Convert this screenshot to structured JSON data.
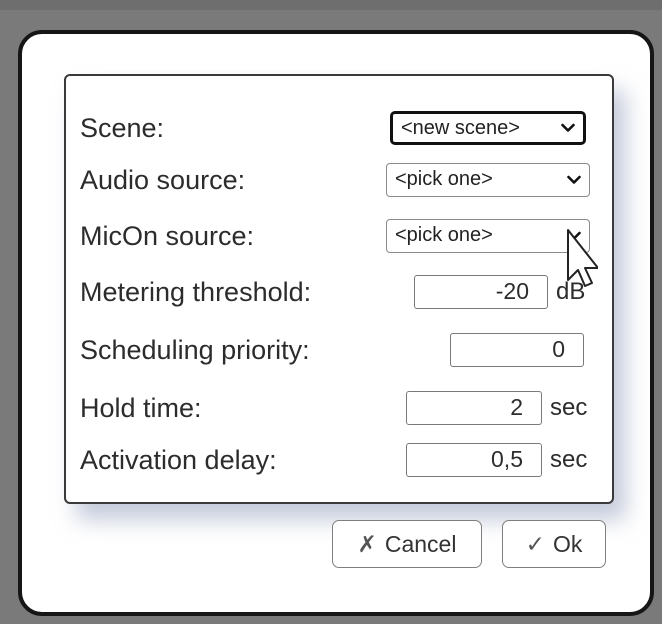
{
  "form": {
    "rows": [
      {
        "label": "Scene:",
        "type": "select",
        "value": "<new scene>"
      },
      {
        "label": "Audio source:",
        "type": "select",
        "value": "<pick one>"
      },
      {
        "label": "MicOn source:",
        "type": "select",
        "value": "<pick one>"
      },
      {
        "label": "Metering threshold:",
        "type": "number",
        "value": "-20",
        "unit": "dB"
      },
      {
        "label": "Scheduling priority:",
        "type": "number",
        "value": "0"
      },
      {
        "label": "Hold time:",
        "type": "number",
        "value": "2",
        "unit": "sec"
      },
      {
        "label": "Activation delay:",
        "type": "number",
        "value": "0,5",
        "unit": "sec"
      }
    ]
  },
  "buttons": {
    "cancel": {
      "icon": "✗",
      "label": "Cancel"
    },
    "ok": {
      "icon": "✓",
      "label": "Ok"
    }
  },
  "colors": {
    "backdrop": "#7a7a7a",
    "dialog_border": "#161616",
    "panel_shadow": "#96a0be"
  }
}
